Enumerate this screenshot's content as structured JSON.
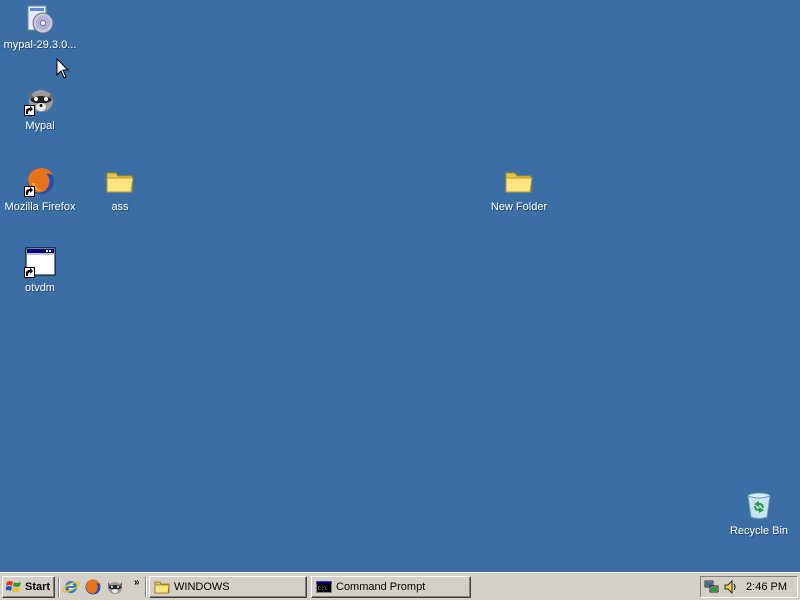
{
  "desktop": {
    "background_color": "#3a6ea5",
    "icons": [
      {
        "name": "mypal-installer",
        "label": "mypal-29.3.0...",
        "icon": "cd-installer-icon",
        "shortcut": false
      },
      {
        "name": "mypal",
        "label": "Mypal",
        "icon": "raccoon-icon",
        "shortcut": true
      },
      {
        "name": "mozilla-firefox",
        "label": "Mozilla Firefox",
        "icon": "firefox-icon",
        "shortcut": true
      },
      {
        "name": "ass",
        "label": "ass",
        "icon": "folder-icon",
        "shortcut": false
      },
      {
        "name": "new-folder",
        "label": "New Folder",
        "icon": "folder-icon",
        "shortcut": false
      },
      {
        "name": "otvdm",
        "label": "otvdm",
        "icon": "window-app-icon",
        "shortcut": true
      },
      {
        "name": "recycle-bin",
        "label": "Recycle Bin",
        "icon": "recycle-bin-icon",
        "shortcut": false
      }
    ]
  },
  "taskbar": {
    "start_label": "Start",
    "quick_launch": [
      {
        "name": "internet-explorer",
        "icon": "ie-icon"
      },
      {
        "name": "firefox",
        "icon": "firefox-icon"
      },
      {
        "name": "mypal",
        "icon": "raccoon-icon"
      }
    ],
    "chevron": "»",
    "tasks": [
      {
        "name": "windows-folder",
        "label": "WINDOWS",
        "icon": "folder-icon"
      },
      {
        "name": "command-prompt",
        "label": "Command Prompt",
        "icon": "cmd-icon"
      }
    ],
    "tray": {
      "icons": [
        "network-tray-icon",
        "volume-tray-icon"
      ],
      "clock": "2:46 PM"
    }
  }
}
